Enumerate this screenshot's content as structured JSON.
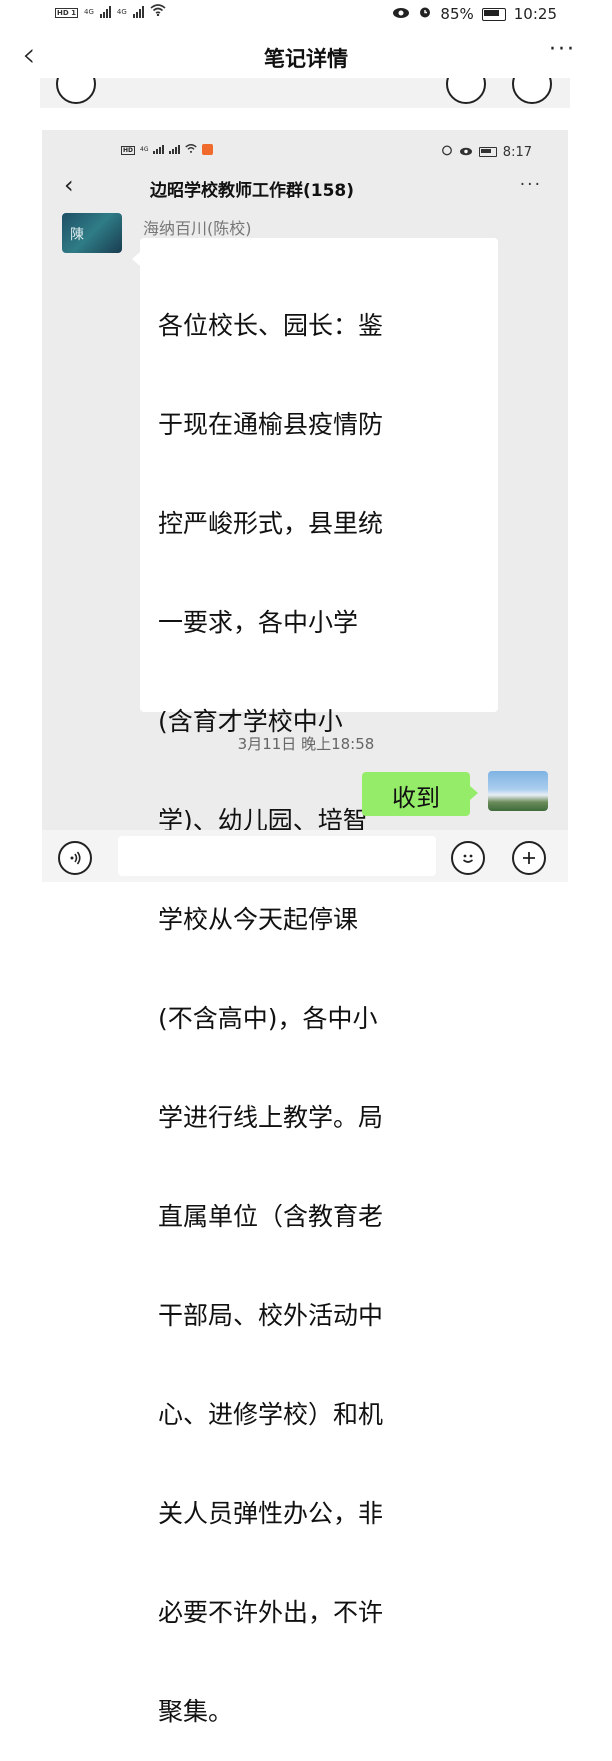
{
  "status_bar": {
    "network_left": "4G",
    "network_right": "4G",
    "battery": "85%",
    "time": "10:25"
  },
  "nav": {
    "back_icon": "chevron-left-icon",
    "title": "笔记详情",
    "more_label": "···"
  },
  "inner_screenshot": {
    "status_bar": {
      "network": "4G",
      "time": "8:17"
    },
    "chat_title": "边昭学校教师工作群(158)",
    "more_label": "···",
    "message": {
      "sender": "海纳百川(陈校)",
      "avatar_text": "陳",
      "lines": [
        "各位校长、园长：鉴",
        "于现在通榆县疫情防",
        "控严峻形式，县里统",
        "一要求，各中小学",
        "(含育才学校中小",
        "学)、幼儿园、培智",
        "学校从今天起停课",
        "(不含高中)，各中小",
        "学进行线上教学。局",
        "直属单位（含教育老",
        "干部局、校外活动中",
        "心、进修学校）和机",
        "关人员弹性办公，非",
        "必要不许外出，不许",
        "聚集。"
      ]
    },
    "timestamp": "3月11日 晚上18:58",
    "reply": {
      "text": "收到"
    }
  },
  "icons": {
    "voice": "voice-icon",
    "emoji": "emoji-icon",
    "plus": "plus-icon"
  },
  "colors": {
    "reply_bubble": "#95ec69",
    "inner_background": "#ececec"
  }
}
